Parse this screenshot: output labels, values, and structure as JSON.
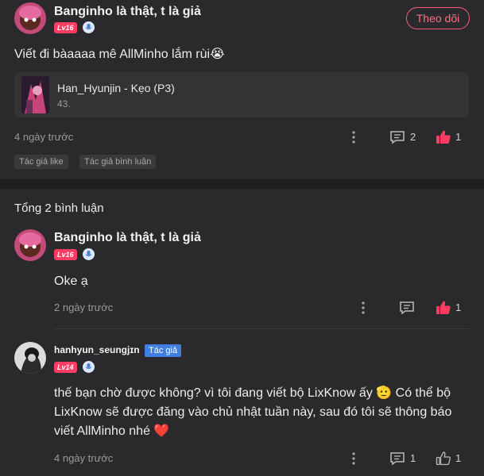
{
  "post": {
    "author": "Banginho là thật, t là giả",
    "level": "Lv16",
    "follow_label": "Theo dõi",
    "text": "Viết đi bàaaaa mê AllMinho lắm rùi😭",
    "quote": {
      "title": "Han_Hyunjin - Kẹo (P3)",
      "subtitle": "43."
    },
    "time": "4 ngày trước",
    "comment_count": "2",
    "like_count": "1",
    "tags": [
      "Tác giả like",
      "Tác giả bình luận"
    ]
  },
  "replies": {
    "header": "Tổng 2 bình luận",
    "items": [
      {
        "author": "Banginho là thật, t là giả",
        "level": "Lv16",
        "text": "Oke ạ",
        "time": "2 ngày trước",
        "like_count": "1"
      },
      {
        "author": "hanhyun_seungjɪn",
        "author_tag": "Tác giả",
        "level": "Lv14",
        "text": "thế bạn chờ được không? vì tôi đang viết bộ LixKnow ấy 🫡 Có thể bộ LixKnow sẽ được đăng vào chủ nhật tuần này, sau đó tôi sẽ thông báo viết AllMinho nhé ❤️",
        "time": "4 ngày trước",
        "comment_count": "1",
        "like_count": "1"
      }
    ]
  },
  "colors": {
    "accent": "#ff3d63",
    "background": "#2a2a2c",
    "author_tag": "#3f7fe0"
  },
  "icons": [
    "more-icon",
    "comment-icon",
    "thumb-up-icon",
    "mic-badge-icon"
  ]
}
